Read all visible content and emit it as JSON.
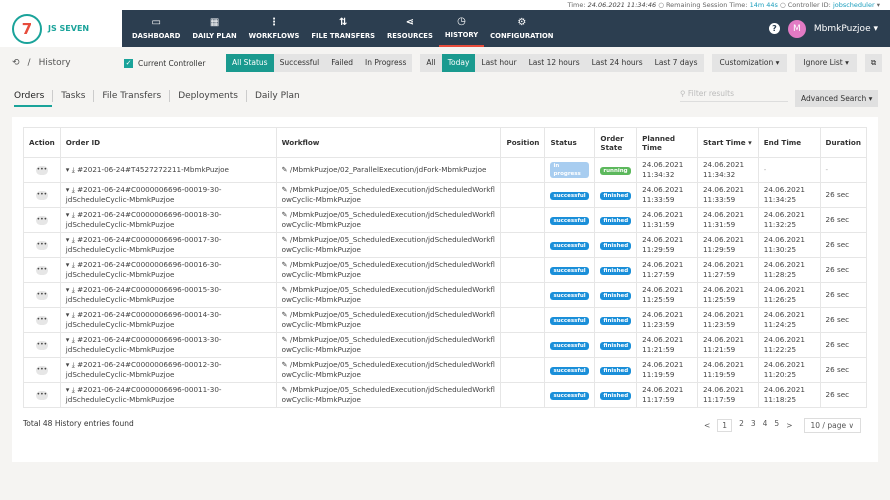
{
  "topbar": {
    "time_label": "Time:",
    "time": "24.06.2021 11:34:46",
    "session_label": "Remaining Session Time:",
    "session": "14m 44s",
    "controller_label": "Controller ID:",
    "controller": "jobscheduler"
  },
  "logo": {
    "mark": "JS7",
    "name": "JS SEVEN"
  },
  "nav": [
    {
      "label": "DASHBOARD",
      "icon": "monitor-icon"
    },
    {
      "label": "DAILY PLAN",
      "icon": "calendar-icon"
    },
    {
      "label": "WORKFLOWS",
      "icon": "workflow-icon"
    },
    {
      "label": "FILE TRANSFERS",
      "icon": "transfer-icon"
    },
    {
      "label": "RESOURCES",
      "icon": "share-icon"
    },
    {
      "label": "HISTORY",
      "icon": "alarm-clock-icon",
      "active": true
    },
    {
      "label": "CONFIGURATION",
      "icon": "gears-icon"
    }
  ],
  "user": {
    "initial": "M",
    "name": "MbmkPuzjoe",
    "avatar_color": "#e27ac4"
  },
  "breadcrumb": {
    "sep": "/",
    "title": "History"
  },
  "current_controller": "Current Controller",
  "status_filters": [
    "All Status",
    "Successful",
    "Failed",
    "In Progress"
  ],
  "time_filters": [
    "All",
    "Today",
    "Last hour",
    "Last 12 hours",
    "Last 24 hours",
    "Last 7 days"
  ],
  "customization": "Customization ▾",
  "ignore_list": "Ignore List ▾",
  "tabs": [
    "Orders",
    "Tasks",
    "File Transfers",
    "Deployments",
    "Daily Plan"
  ],
  "filter_placeholder": "Filter results",
  "advanced_search": "Advanced Search ▾",
  "columns": [
    "Action",
    "Order ID",
    "Workflow",
    "Position",
    "Status",
    "Order State",
    "Planned Time",
    "Start Time ▾",
    "End Time",
    "Duration"
  ],
  "rows": [
    {
      "order": "#2021-06-24#T4527272211-MbmkPuzjoe",
      "workflow": "/MbmkPuzjoe/02_ParallelExecution/jdFork-MbmkPuzjoe",
      "status": "in progress",
      "state": "running",
      "planned": "24.06.2021 11:34:32",
      "start": "24.06.2021 11:34:32",
      "end": "-",
      "duration": "-"
    },
    {
      "order": "#2021-06-24#C0000006696-00019-30-jdScheduleCyclic-MbmkPuzjoe",
      "workflow": "/MbmkPuzjoe/05_ScheduledExecution/jdScheduledWorkflowCyclic-MbmkPuzjoe",
      "status": "successful",
      "state": "finished",
      "planned": "24.06.2021 11:33:59",
      "start": "24.06.2021 11:33:59",
      "end": "24.06.2021 11:34:25",
      "duration": "26 sec"
    },
    {
      "order": "#2021-06-24#C0000006696-00018-30-jdScheduleCyclic-MbmkPuzjoe",
      "workflow": "/MbmkPuzjoe/05_ScheduledExecution/jdScheduledWorkflowCyclic-MbmkPuzjoe",
      "status": "successful",
      "state": "finished",
      "planned": "24.06.2021 11:31:59",
      "start": "24.06.2021 11:31:59",
      "end": "24.06.2021 11:32:25",
      "duration": "26 sec"
    },
    {
      "order": "#2021-06-24#C0000006696-00017-30-jdScheduleCyclic-MbmkPuzjoe",
      "workflow": "/MbmkPuzjoe/05_ScheduledExecution/jdScheduledWorkflowCyclic-MbmkPuzjoe",
      "status": "successful",
      "state": "finished",
      "planned": "24.06.2021 11:29:59",
      "start": "24.06.2021 11:29:59",
      "end": "24.06.2021 11:30:25",
      "duration": "26 sec"
    },
    {
      "order": "#2021-06-24#C0000006696-00016-30-jdScheduleCyclic-MbmkPuzjoe",
      "workflow": "/MbmkPuzjoe/05_ScheduledExecution/jdScheduledWorkflowCyclic-MbmkPuzjoe",
      "status": "successful",
      "state": "finished",
      "planned": "24.06.2021 11:27:59",
      "start": "24.06.2021 11:27:59",
      "end": "24.06.2021 11:28:25",
      "duration": "26 sec"
    },
    {
      "order": "#2021-06-24#C0000006696-00015-30-jdScheduleCyclic-MbmkPuzjoe",
      "workflow": "/MbmkPuzjoe/05_ScheduledExecution/jdScheduledWorkflowCyclic-MbmkPuzjoe",
      "status": "successful",
      "state": "finished",
      "planned": "24.06.2021 11:25:59",
      "start": "24.06.2021 11:25:59",
      "end": "24.06.2021 11:26:25",
      "duration": "26 sec"
    },
    {
      "order": "#2021-06-24#C0000006696-00014-30-jdScheduleCyclic-MbmkPuzjoe",
      "workflow": "/MbmkPuzjoe/05_ScheduledExecution/jdScheduledWorkflowCyclic-MbmkPuzjoe",
      "status": "successful",
      "state": "finished",
      "planned": "24.06.2021 11:23:59",
      "start": "24.06.2021 11:23:59",
      "end": "24.06.2021 11:24:25",
      "duration": "26 sec"
    },
    {
      "order": "#2021-06-24#C0000006696-00013-30-jdScheduleCyclic-MbmkPuzjoe",
      "workflow": "/MbmkPuzjoe/05_ScheduledExecution/jdScheduledWorkflowCyclic-MbmkPuzjoe",
      "status": "successful",
      "state": "finished",
      "planned": "24.06.2021 11:21:59",
      "start": "24.06.2021 11:21:59",
      "end": "24.06.2021 11:22:25",
      "duration": "26 sec"
    },
    {
      "order": "#2021-06-24#C0000006696-00012-30-jdScheduleCyclic-MbmkPuzjoe",
      "workflow": "/MbmkPuzjoe/05_ScheduledExecution/jdScheduledWorkflowCyclic-MbmkPuzjoe",
      "status": "successful",
      "state": "finished",
      "planned": "24.06.2021 11:19:59",
      "start": "24.06.2021 11:19:59",
      "end": "24.06.2021 11:20:25",
      "duration": "26 sec"
    },
    {
      "order": "#2021-06-24#C0000006696-00011-30-jdScheduleCyclic-MbmkPuzjoe",
      "workflow": "/MbmkPuzjoe/05_ScheduledExecution/jdScheduledWorkflowCyclic-MbmkPuzjoe",
      "status": "successful",
      "state": "finished",
      "planned": "24.06.2021 11:17:59",
      "start": "24.06.2021 11:17:59",
      "end": "24.06.2021 11:18:25",
      "duration": "26 sec"
    }
  ],
  "badge_colors": {
    "in progress": "#a8cdf0",
    "running": "#5cb85c",
    "successful": "#1a8fd9",
    "finished": "#1a8fd9"
  },
  "total": "Total 48 History entries found",
  "pagination": {
    "prev": "<",
    "pages": [
      "1",
      "2",
      "3",
      "4",
      "5"
    ],
    "next": ">",
    "per_page": "10 / page ∨"
  }
}
